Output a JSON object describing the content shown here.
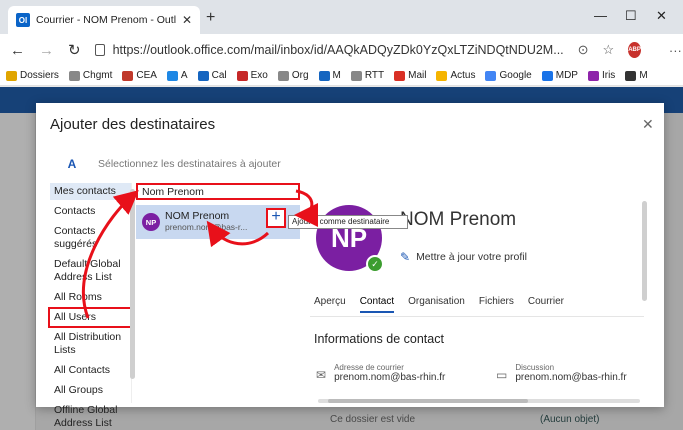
{
  "browser": {
    "tab_title": "Courrier - NOM Prenom - Outlo",
    "tab_favicon": "Ol",
    "url": "https://outlook.office.com/mail/inbox/id/AAQkADQyZDk0YzQxLTZiNDQtNDU2M...",
    "bookmarks": [
      {
        "label": "Dossiers",
        "icon": "folder-icon",
        "color": "#e0a500"
      },
      {
        "label": "Chgmt",
        "icon": "page-icon",
        "color": "#888888"
      },
      {
        "label": "CEA",
        "icon": "cea-icon",
        "color": "#c0392b"
      },
      {
        "label": "A",
        "icon": "a-icon",
        "color": "#1e88e5"
      },
      {
        "label": "Cal",
        "icon": "cal-icon",
        "color": "#1565c0"
      },
      {
        "label": "Exo",
        "icon": "exo-icon",
        "color": "#c62828"
      },
      {
        "label": "Org",
        "icon": "page-icon",
        "color": "#888888"
      },
      {
        "label": "M",
        "icon": "m-icon",
        "color": "#1565c0"
      },
      {
        "label": "RTT",
        "icon": "page-icon",
        "color": "#888888"
      },
      {
        "label": "Mail",
        "icon": "gmail-icon",
        "color": "#d93025"
      },
      {
        "label": "Actus",
        "icon": "actus-icon",
        "color": "#f5b400"
      },
      {
        "label": "Google",
        "icon": "google-icon",
        "color": "#4285f4"
      },
      {
        "label": "MDP",
        "icon": "mdp-icon",
        "color": "#1a73e8"
      },
      {
        "label": "Iris",
        "icon": "iris-icon",
        "color": "#8e24aa"
      },
      {
        "label": "M",
        "icon": "m2-icon",
        "color": "#333333"
      }
    ]
  },
  "modal": {
    "title": "Ajouter des destinataires",
    "search_letter": "A",
    "search_hint": "Sélectionnez les destinataires à ajouter",
    "left_items": [
      {
        "label": "Mes contacts",
        "state": "active"
      },
      {
        "label": "Contacts",
        "state": ""
      },
      {
        "label": "Contacts suggérés",
        "state": ""
      },
      {
        "label": "Default Global Address List",
        "state": ""
      },
      {
        "label": "All Rooms",
        "state": ""
      },
      {
        "label": "All Users",
        "state": "hl"
      },
      {
        "label": "All Distribution Lists",
        "state": ""
      },
      {
        "label": "All Contacts",
        "state": ""
      },
      {
        "label": "All Groups",
        "state": ""
      },
      {
        "label": "Offline Global Address List",
        "state": ""
      }
    ],
    "search_value": "Nom Prenom",
    "result": {
      "initials": "NP",
      "name": "NOM Prenom",
      "email": "prenom.nom@bas-r..."
    },
    "add_symbol": "+",
    "tooltip": "Ajouter comme destinataire",
    "profile": {
      "initials": "NP",
      "name": "NOM Prenom",
      "update_label": "Mettre à jour votre profil",
      "tabs": [
        "Aperçu",
        "Contact",
        "Organisation",
        "Fichiers",
        "Courrier"
      ],
      "active_tab": "Contact",
      "section_title": "Informations de contact",
      "email_label": "Adresse de courrier",
      "email_value": "prenom.nom@bas-rhin.fr",
      "im_label": "Discussion",
      "im_value": "prenom.nom@bas-rhin.fr"
    }
  },
  "page_behind": {
    "bottom_left": "Ce dossier est vide",
    "bottom_right": "(Aucun objet)"
  },
  "accent_red": "#e8101a"
}
